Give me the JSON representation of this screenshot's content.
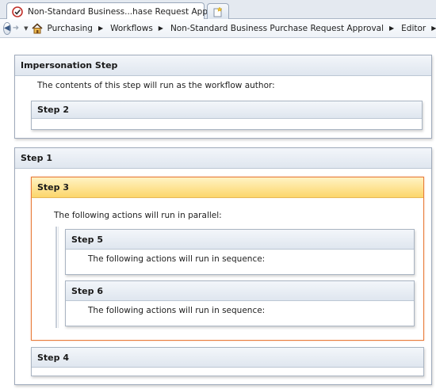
{
  "tab": {
    "title": "Non-Standard Business...hase Request Approval"
  },
  "breadcrumb": {
    "items": [
      "Purchasing",
      "Workflows",
      "Non-Standard Business Purchase Request Approval",
      "Editor"
    ]
  },
  "impersonation": {
    "title": "Impersonation Step",
    "description": "The contents of this step will run as the workflow author:",
    "step2_title": "Step 2"
  },
  "step1": {
    "title": "Step 1",
    "step3": {
      "title": "Step 3",
      "description": "The following actions will run in parallel:",
      "step5": {
        "title": "Step 5",
        "description": "The following actions will run in sequence:"
      },
      "step6": {
        "title": "Step 6",
        "description": "The following actions will run in sequence:"
      }
    },
    "step4_title": "Step 4"
  },
  "colors": {
    "selected_border": "#e87b3a",
    "selected_header": "#fcd66b",
    "header_blue": "#dfe6ef"
  }
}
